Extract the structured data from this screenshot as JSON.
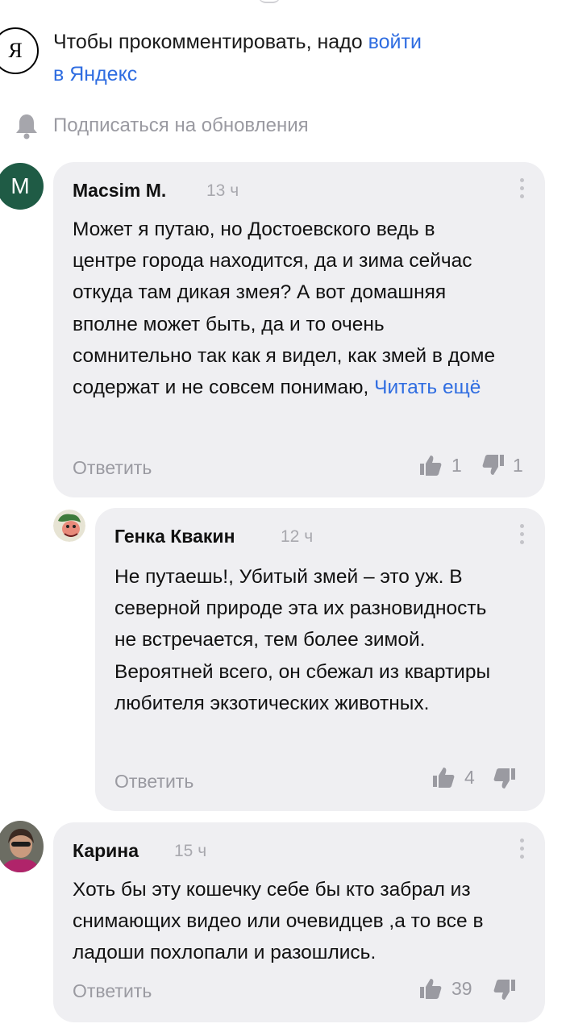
{
  "login": {
    "prefix": "Чтобы прокомментировать, надо ",
    "link_line1": "войти",
    "link_line2": "в Яндекс",
    "logo_letter": "Я"
  },
  "subscribe": {
    "label": "Подписаться на обновления",
    "icon": "bell-icon"
  },
  "colors": {
    "link": "#2f6de1",
    "bubble": "#efeff2",
    "muted": "#9a9aa1",
    "avatar_m": "#1f5b45"
  },
  "comments": [
    {
      "avatar_letter": "M",
      "author": "Macsim M.",
      "time": "13 ч",
      "text": "Может я путаю, но Достоевского ведь в центре города находится, да и зима сейчас откуда там дикая змея? А вот домашняя вполне может быть, да и то очень сомнительно так как я видел, как змей в доме содержат и не совсем понимаю,",
      "read_more": "Читать ещё",
      "reply": "Ответить",
      "likes": "1",
      "dislikes": "1"
    },
    {
      "author": "Генка Квакин",
      "time": "12 ч",
      "text": "Не путаешь!, Убитый змей – это уж. В северной природе эта их разновидность не встречается, тем более зимой. Вероятней всего, он сбежал из квартиры любителя экзотических животных.",
      "reply": "Ответить",
      "likes": "4",
      "dislikes": ""
    },
    {
      "author": "Карина",
      "time": "15 ч",
      "text": "Хоть бы эту кошечку себе бы кто забрал из снимающих видео или очевидцев ,а то все в ладоши похлопали  и разошлись.",
      "reply": "Ответить",
      "likes": "39",
      "dislikes": ""
    }
  ]
}
